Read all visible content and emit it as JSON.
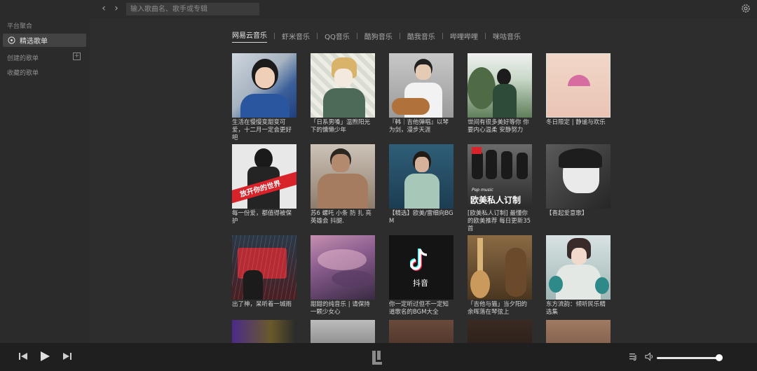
{
  "search": {
    "placeholder": "输入歌曲名、歌手或专辑"
  },
  "sidebar": {
    "platform_title": "平台聚合",
    "active_item": "精选歌单",
    "created_title": "创建的歌单",
    "collected_title": "收藏的歌单"
  },
  "tabs": [
    "网易云音乐",
    "虾米音乐",
    "QQ音乐",
    "酷狗音乐",
    "酷我音乐",
    "哔哩哔哩",
    "咪咕音乐"
  ],
  "playlists": [
    "生活在慢慢变甜变可爱，十二月一定会更好吧",
    "「日系男嗓」温煦阳光下的慵懒少年",
    "『韩｜吉他弹唱』以琴为剑，漫步天涯",
    "世间有很多美好等你 你要内心温柔 安静努力",
    "冬日限定 | 静谧与欢乐",
    "每一份爱，都值得被保护",
    "苏6 螺吒 小条 防 扎 亮 英雄会 抖腿.",
    "【精选】欧美/雷细向BGM",
    "[欧美私人订制] 最懂你的欧美推荐 每日更新35首",
    "【喜起爱意歌】",
    "出了神，呆听着一城雨",
    "甜甜的纯音乐 | 请保持一颗少女心",
    "你一定听过但不一定知道歌名的BGM大全",
    "「吉他与猫」当夕阳的余晖落在琴弦上",
    "东方流韵：倾听民乐精选集",
    "",
    "",
    "",
    "",
    ""
  ],
  "covers": {
    "c6_text": "欧美私人订制",
    "c6_small": "Pop music",
    "c12_text": "抖音",
    "c5_text": "放开你的世界"
  },
  "colors": {
    "accent": "#e8e8e8",
    "bg": "#2d2d2d",
    "sidebar": "#2b2b2b",
    "player": "#1f1f1f"
  }
}
